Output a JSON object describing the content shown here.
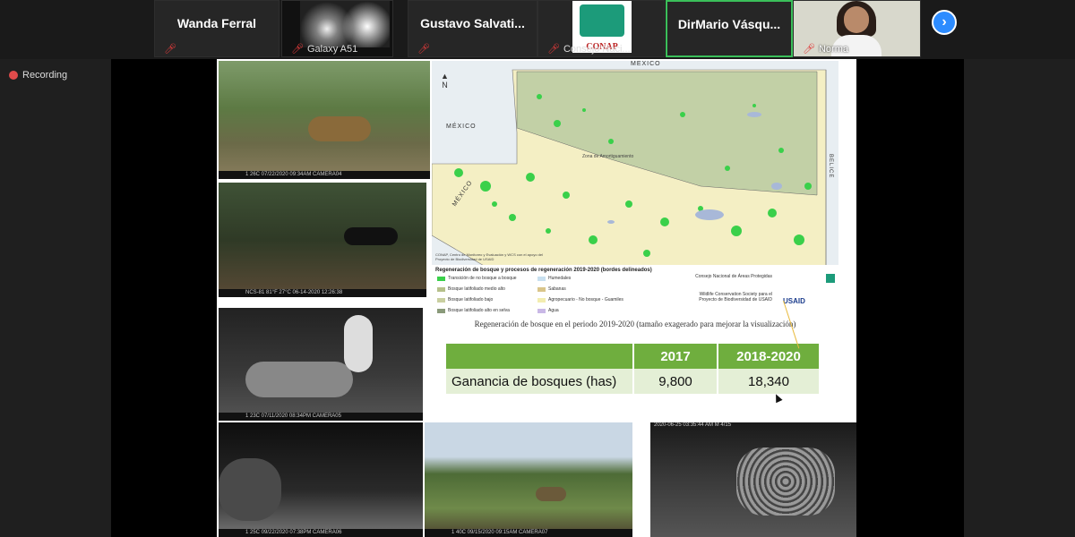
{
  "participants": [
    {
      "name": "Wanda Ferral",
      "label": ""
    },
    {
      "name": "",
      "label": "Galaxy A51"
    },
    {
      "name": "Gustavo  Salvati...",
      "label": ""
    },
    {
      "name": "",
      "label": "Consejo Naci..."
    },
    {
      "name": "DirMario  Vásqu...",
      "label": ""
    },
    {
      "name": "",
      "label": "Norma"
    }
  ],
  "org_logo_text": "CONAP",
  "recording_label": "Recording",
  "map": {
    "country_labels": [
      "MÉXICO",
      "MÉXICO",
      "MÉXICO",
      "BELICE"
    ],
    "zone_label": "Zona de Amortiguamiento",
    "north_label": "N"
  },
  "legend": {
    "title": "Regeneración de bosque y procesos de regeneración 2019-2020 (bordes delineados)",
    "items": [
      {
        "label": "Transición de no bosque a bosque",
        "color": "#3ad04a"
      },
      {
        "label": "Bosque latifoliado medio alto",
        "color": "#b5c08a"
      },
      {
        "label": "Bosque latifoliado bajo",
        "color": "#c9cfa0"
      },
      {
        "label": "Bosque latifoliado alto en selva",
        "color": "#8a9a7a"
      },
      {
        "label": "Humedales",
        "color": "#c8e0f0"
      },
      {
        "label": "Sabanas",
        "color": "#d9c58a"
      },
      {
        "label": "Agropecuario - No bosque - Guamiles",
        "color": "#f3edb0"
      },
      {
        "label": "Agua",
        "color": "#c9b8e6"
      }
    ],
    "credit": "CONAP, Centro de Monitoreo y Evaluación y WCS con el apoyo del Proyecto de Biodiversidad de USAID",
    "orgs": [
      "Consejo Nacional de Áreas Protegidas",
      "Wildlife Conservation Society para el Proyecto de Biodiversidad de USAID"
    ],
    "usaid": "USAID"
  },
  "caption": "Regeneración de bosque en el periodo 2019-2020 (tamaño exagerado para mejorar la visualización)",
  "table": {
    "headers": [
      "",
      "2017",
      "2018-2020"
    ],
    "row_label": "Ganancia de bosques (has)",
    "values": [
      "9,800",
      "18,340"
    ]
  },
  "photo_captions": [
    "1 26C  07/22/2020  09:34AM  CAMERA04",
    "NCS-81   81°F 27°C   06-14-2020   12:26:38",
    "1 23C  07/11/2020  08:34PM  CAMERA05",
    "1 25C  09/22/2020  07:38PM  CAMERA06",
    "1 40C  09/15/2020  09:15AM  CAMERA07",
    "2020-06-25  03:35:44 AM   M 4/15"
  ],
  "colors": {
    "accent": "#2d8cff",
    "table_header": "#6fae3e",
    "table_body": "#e4efd6",
    "rec": "#e04b4b"
  }
}
